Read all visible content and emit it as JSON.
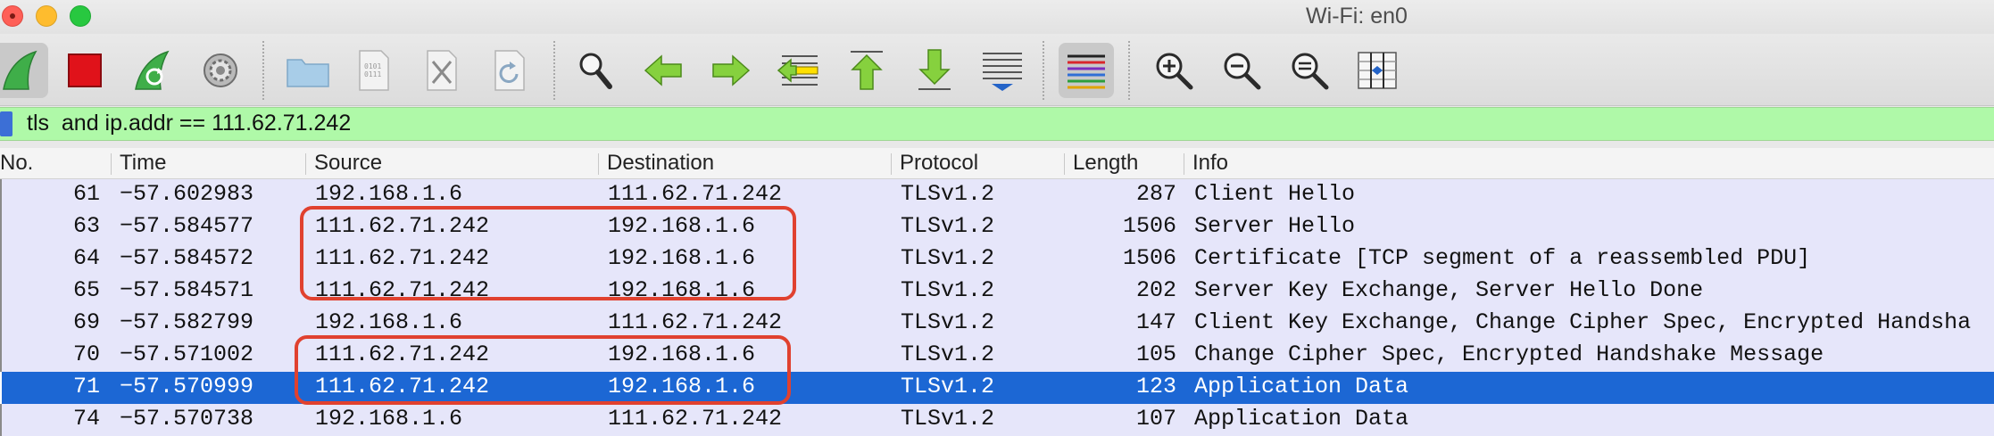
{
  "window": {
    "title": "Wi-Fi: en0"
  },
  "toolbar": {
    "buttons": [
      {
        "name": "start-capture-icon"
      },
      {
        "name": "stop-capture-icon"
      },
      {
        "name": "restart-capture-icon"
      },
      {
        "name": "capture-options-icon"
      },
      {
        "name": "open-file-icon"
      },
      {
        "name": "save-file-icon"
      },
      {
        "name": "close-file-icon"
      },
      {
        "name": "reload-file-icon"
      },
      {
        "name": "find-packet-icon"
      },
      {
        "name": "go-back-icon"
      },
      {
        "name": "go-forward-icon"
      },
      {
        "name": "go-to-packet-icon"
      },
      {
        "name": "go-first-packet-icon"
      },
      {
        "name": "go-last-packet-icon"
      },
      {
        "name": "auto-scroll-icon"
      },
      {
        "name": "colorize-icon"
      },
      {
        "name": "zoom-in-icon"
      },
      {
        "name": "zoom-out-icon"
      },
      {
        "name": "zoom-normal-icon"
      },
      {
        "name": "resize-columns-icon"
      }
    ]
  },
  "filter": {
    "value": "tls  and ip.addr == 111.62.71.242"
  },
  "columns": {
    "no": "No.",
    "time": "Time",
    "source": "Source",
    "destination": "Destination",
    "protocol": "Protocol",
    "length": "Length",
    "info": "Info"
  },
  "packets": [
    {
      "no": "61",
      "time": "−57.602983",
      "source": "192.168.1.6",
      "destination": "111.62.71.242",
      "protocol": "TLSv1.2",
      "length": "287",
      "info": "Client Hello",
      "selected": false
    },
    {
      "no": "63",
      "time": "−57.584577",
      "source": "111.62.71.242",
      "destination": "192.168.1.6",
      "protocol": "TLSv1.2",
      "length": "1506",
      "info": "Server Hello",
      "selected": false
    },
    {
      "no": "64",
      "time": "−57.584572",
      "source": "111.62.71.242",
      "destination": "192.168.1.6",
      "protocol": "TLSv1.2",
      "length": "1506",
      "info": "Certificate [TCP segment of a reassembled PDU]",
      "selected": false
    },
    {
      "no": "65",
      "time": "−57.584571",
      "source": "111.62.71.242",
      "destination": "192.168.1.6",
      "protocol": "TLSv1.2",
      "length": "202",
      "info": "Server Key Exchange, Server Hello Done",
      "selected": false
    },
    {
      "no": "69",
      "time": "−57.582799",
      "source": "192.168.1.6",
      "destination": "111.62.71.242",
      "protocol": "TLSv1.2",
      "length": "147",
      "info": "Client Key Exchange, Change Cipher Spec, Encrypted Handsha",
      "selected": false
    },
    {
      "no": "70",
      "time": "−57.571002",
      "source": "111.62.71.242",
      "destination": "192.168.1.6",
      "protocol": "TLSv1.2",
      "length": "105",
      "info": "Change Cipher Spec, Encrypted Handshake Message",
      "selected": false
    },
    {
      "no": "71",
      "time": "−57.570999",
      "source": "111.62.71.242",
      "destination": "192.168.1.6",
      "protocol": "TLSv1.2",
      "length": "123",
      "info": "Application Data",
      "selected": true
    },
    {
      "no": "74",
      "time": "−57.570738",
      "source": "192.168.1.6",
      "destination": "111.62.71.242",
      "protocol": "TLSv1.2",
      "length": "107",
      "info": "Application Data",
      "selected": false
    }
  ],
  "colors": {
    "row_background": "#e6e6fa",
    "selected_row": "#1c67d4",
    "filter_valid": "#aff9a8",
    "annotation_box": "#e0412f"
  }
}
